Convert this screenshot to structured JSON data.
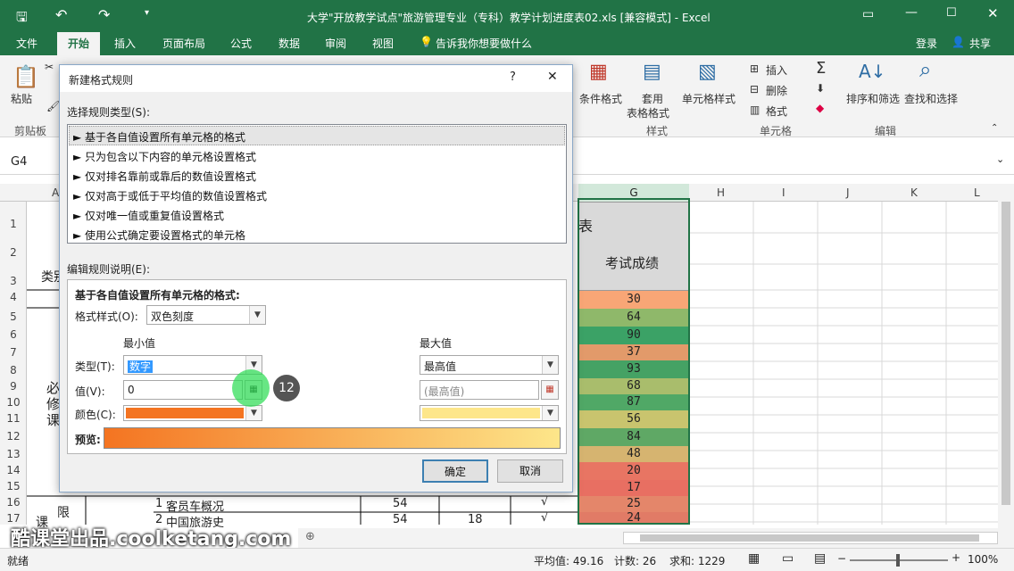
{
  "window": {
    "title": "大学\"开放教学试点\"旅游管理专业（专科）教学计划进度表02.xls  [兼容模式] - Excel"
  },
  "tabs": [
    "文件",
    "开始",
    "插入",
    "页面布局",
    "公式",
    "数据",
    "审阅",
    "视图"
  ],
  "tell_me": "告诉我你想要做什么",
  "login": "登录",
  "share": "共享",
  "ribbon": {
    "paste": "粘贴",
    "clipboard": "剪贴板",
    "cond_format": "条件格式",
    "table_fmt1": "套用",
    "table_fmt2": "表格格式",
    "cell_style": "单元格样式",
    "style_group": "样式",
    "insert": "插入",
    "delete": "删除",
    "format": "格式",
    "cells_group": "单元格",
    "sort": "排序和筛选",
    "find": "查找和选择",
    "edit_group": "编辑"
  },
  "namebox": "G4",
  "columns": [
    "A",
    "G",
    "H",
    "I",
    "J",
    "K",
    "L"
  ],
  "rows": [
    "1",
    "2",
    "3",
    "4",
    "5",
    "6",
    "7",
    "8",
    "9",
    "10",
    "11",
    "12",
    "13",
    "14",
    "15",
    "16",
    "17"
  ],
  "g_column": {
    "header": "考试成绩",
    "title_frag": "表",
    "values": [
      "30",
      "64",
      "90",
      "37",
      "93",
      "68",
      "87",
      "56",
      "84",
      "48",
      "20",
      "17",
      "25",
      "24"
    ],
    "colors": [
      "#f8a676",
      "#8fb86a",
      "#3ba266",
      "#e29a6a",
      "#45a264",
      "#a9bd6c",
      "#50a866",
      "#c9c46e",
      "#5fa865",
      "#d6b470",
      "#e87563",
      "#e86f62",
      "#e4866a",
      "#e17b66"
    ]
  },
  "sheet": {
    "a3": "类别",
    "a9": "必",
    "a10": "修",
    "a11": "课",
    "a16": "限",
    "a17": "课",
    "r16": {
      "num": "1",
      "name": "客员车概况",
      "d": "54",
      "check": "√"
    },
    "r17": {
      "num": "2",
      "name": "中国旅游史",
      "d": "54",
      "e": "18",
      "check": "√"
    }
  },
  "watermark": "酷课堂出品.coolketang.com",
  "step_badge": "12",
  "status": {
    "ready": "就绪",
    "avg": "平均值: 49.16",
    "count": "计数: 26",
    "sum": "求和: 1229",
    "zoom": "100%"
  },
  "dialog": {
    "title": "新建格式规则",
    "help": "?",
    "close": "✕",
    "select_label": "选择规则类型(S):",
    "rule_types": [
      "► 基于各自值设置所有单元格的格式",
      "► 只为包含以下内容的单元格设置格式",
      "► 仅对排名靠前或靠后的数值设置格式",
      "► 仅对高于或低于平均值的数值设置格式",
      "► 仅对唯一值或重复值设置格式",
      "► 使用公式确定要设置格式的单元格"
    ],
    "edit_label": "编辑规则说明(E):",
    "desc_title": "基于各自值设置所有单元格的格式:",
    "format_style_label": "格式样式(O):",
    "format_style": "双色刻度",
    "min_header": "最小值",
    "max_header": "最大值",
    "type_label": "类型(T):",
    "min_type": "数字",
    "max_type": "最高值",
    "value_label": "值(V):",
    "min_value": "0",
    "max_value": "(最高值)",
    "color_label": "颜色(C):",
    "min_color": "#f47421",
    "max_color": "#fde68a",
    "preview_label": "预览:",
    "ok": "确定",
    "cancel": "取消"
  }
}
